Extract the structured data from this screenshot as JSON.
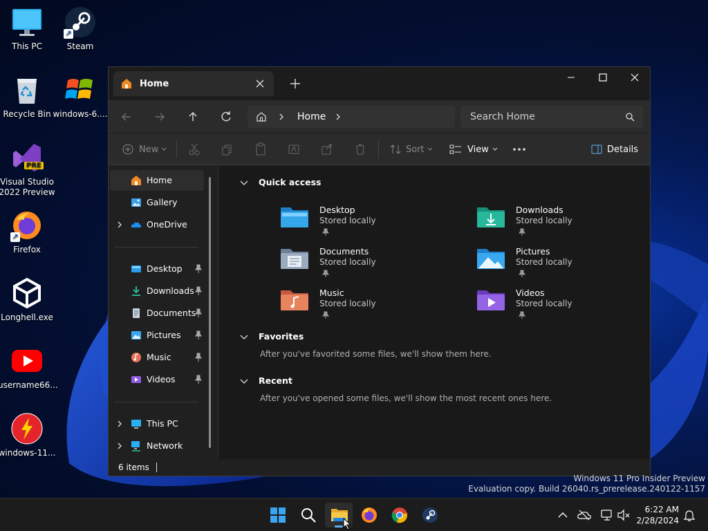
{
  "desktop": {
    "icons": [
      {
        "label": "This PC",
        "icon": "monitor-icon"
      },
      {
        "label": "Steam",
        "icon": "steam-icon"
      },
      {
        "label": "Recycle Bin",
        "icon": "recycle-bin-icon"
      },
      {
        "label": "windows-6....",
        "icon": "windows-logo-icon"
      },
      {
        "label": "Visual Studio 2022 Preview",
        "icon": "visual-studio-icon",
        "badge": "PRE"
      },
      {
        "label": "Firefox",
        "icon": "firefox-icon"
      },
      {
        "label": "Longhell.exe",
        "icon": "unity-icon"
      },
      {
        "label": "username66...",
        "icon": "youtube-icon"
      },
      {
        "label": "windows-11...",
        "icon": "flash-icon"
      }
    ]
  },
  "explorer": {
    "tab_title": "Home",
    "breadcrumb": "Home",
    "search_placeholder": "Search Home",
    "toolbar": {
      "new": "New",
      "sort": "Sort",
      "view": "View",
      "details": "Details"
    },
    "sidebar": {
      "top": [
        {
          "label": "Home",
          "icon": "home-icon",
          "selected": true
        },
        {
          "label": "Gallery",
          "icon": "gallery-icon"
        },
        {
          "label": "OneDrive",
          "icon": "onedrive-icon"
        }
      ],
      "pinned": [
        {
          "label": "Desktop",
          "icon": "desktop-folder-icon"
        },
        {
          "label": "Downloads",
          "icon": "downloads-folder-icon"
        },
        {
          "label": "Documents",
          "icon": "documents-folder-icon"
        },
        {
          "label": "Pictures",
          "icon": "pictures-folder-icon"
        },
        {
          "label": "Music",
          "icon": "music-folder-icon"
        },
        {
          "label": "Videos",
          "icon": "videos-folder-icon"
        }
      ],
      "bottom": [
        {
          "label": "This PC",
          "icon": "this-pc-icon"
        },
        {
          "label": "Network",
          "icon": "network-icon"
        }
      ]
    },
    "sections": {
      "quick_access": "Quick access",
      "favorites": "Favorites",
      "favorites_note": "After you've favorited some files, we'll show them here.",
      "recent": "Recent",
      "recent_note": "After you've opened some files, we'll show the most recent ones here."
    },
    "quick_access_items": [
      {
        "name": "Desktop",
        "status": "Stored locally",
        "color": "#2b9de6"
      },
      {
        "name": "Downloads",
        "status": "Stored locally",
        "color": "#22b39a"
      },
      {
        "name": "Documents",
        "status": "Stored locally",
        "color": "#8aa0b8"
      },
      {
        "name": "Pictures",
        "status": "Stored locally",
        "color": "#3aa8f0"
      },
      {
        "name": "Music",
        "status": "Stored locally",
        "color": "#e8735a"
      },
      {
        "name": "Videos",
        "status": "Stored locally",
        "color": "#8f5ce0"
      }
    ],
    "status": "6 items"
  },
  "watermark": {
    "line1": "Windows 11 Pro Insider Preview",
    "line2": "Evaluation copy. Build 26040.rs_prerelease.240122-1157"
  },
  "taskbar": {
    "apps": [
      "start-icon",
      "search-icon",
      "file-explorer-icon",
      "firefox-icon",
      "chrome-icon",
      "steam-icon"
    ],
    "time": "6:22 AM",
    "date": "2/28/2024"
  }
}
